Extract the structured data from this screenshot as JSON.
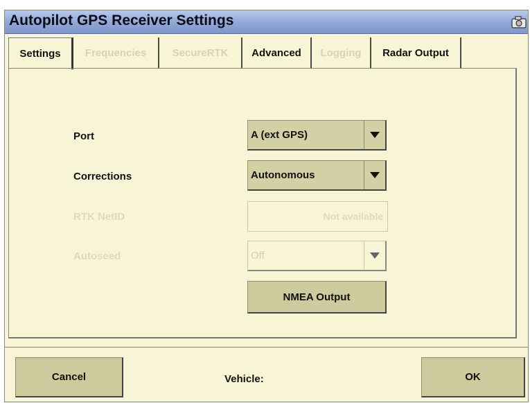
{
  "window": {
    "title": "Autopilot GPS Receiver Settings",
    "title_icon": "camera-icon"
  },
  "tabs": [
    {
      "label": "Settings",
      "state": "active"
    },
    {
      "label": "Frequencies",
      "state": "disabled"
    },
    {
      "label": "SecureRTK",
      "state": "disabled"
    },
    {
      "label": "Advanced",
      "state": "enabled"
    },
    {
      "label": "Logging",
      "state": "disabled"
    },
    {
      "label": "Radar Output",
      "state": "enabled"
    }
  ],
  "settings": {
    "port": {
      "label": "Port",
      "value": "A (ext GPS)"
    },
    "corrections": {
      "label": "Corrections",
      "value": "Autonomous"
    },
    "rtk_netid": {
      "label": "RTK NetID",
      "value": "Not available"
    },
    "autoseed": {
      "label": "Autoseed",
      "value": "Off"
    },
    "nmea_button": "NMEA Output"
  },
  "footer": {
    "cancel_label": "Cancel",
    "vehicle_label": "Vehicle:",
    "ok_label": "OK"
  },
  "colors": {
    "background": "#f7f5d6",
    "titlebar": "#8fa6d6",
    "button": "#cdca9d",
    "disabled_text": "#dedaba"
  }
}
